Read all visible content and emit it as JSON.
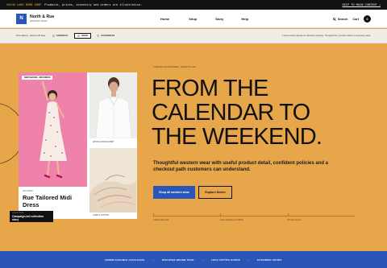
{
  "topbar": {
    "promo": "SOCHO LABS DEMO SHOP",
    "message": "Products, prices, inventory and orders are illustrative.",
    "link": "SKIP TO MAIN CONTENT →"
  },
  "header": {
    "logo_letter": "N",
    "brand_name": "North & Rue",
    "brand_tagline": "WESTERN WEAR",
    "nav": [
      "Home",
      "Shop",
      "Story",
      "Help"
    ],
    "search_label": "Search",
    "cart_label": "Cart",
    "cart_count": "0"
  },
  "filterbar": {
    "breadcrumb": "Free delivery · Returns 30 days",
    "chips": [
      "ESSENTIAL",
      "DENIM",
      "OUTERWEAR"
    ],
    "active_chip_index": 1,
    "note": "A well-curated capsule for effortless dressing. Thoughtful fits, premium fabrics & everyday value."
  },
  "cards": {
    "main_tag": "NEW SEASON · MIDI DRESS",
    "main_kicker": "FEATURED",
    "main_title": "Rue Tailored Midi Dress",
    "shirt_caption": "WHITE OXFORD SHIRT",
    "fabric_caption": "LINEN & COTTON"
  },
  "badge": {
    "kicker": "COLLECTION",
    "title": "Campaign-led collection story"
  },
  "hero": {
    "eyebrow": "CURATED IN CALIFORNIA · MADE TO LAST",
    "headline": "FROM THE CALENDAR TO THE WEEKEND.",
    "subtext": "Thoughtful western wear with useful product detail, confident policies and a checkout path customers can understand.",
    "primary_cta": "Shop all western wear",
    "secondary_cta": "Explore Denim",
    "stats": [
      "Crafted with care",
      "Free shipping over $150",
      "30-day returns"
    ]
  },
  "footer": {
    "items": [
      "DOWNLOADABLE CATALOGUE",
      "DISCOVER BRAND TOUR",
      "100% COTTON GOODS",
      "EXTENDED HOURS"
    ]
  },
  "colors": {
    "hero_bg": "#e7a64a",
    "brand_blue": "#2a56b8",
    "card_pink": "#ee82aa",
    "ink": "#111111"
  }
}
